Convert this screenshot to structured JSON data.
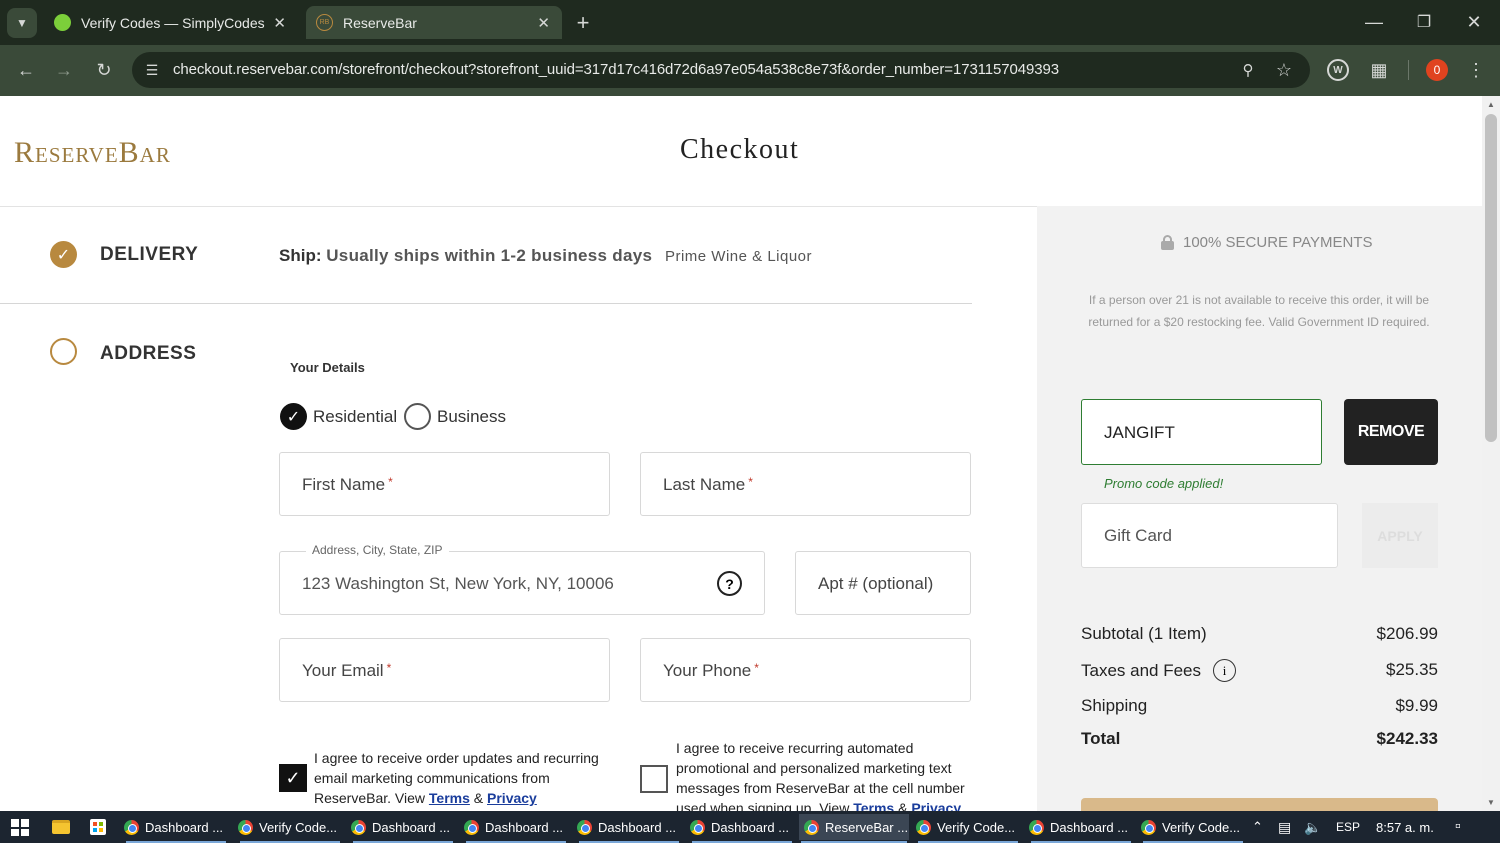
{
  "browser": {
    "tabs": [
      {
        "title": "Verify Codes — SimplyCodes",
        "close": "✕"
      },
      {
        "title": "ReserveBar",
        "favicon": "RB",
        "close": "✕"
      }
    ],
    "new_tab": "+",
    "url": "checkout.reservebar.com/storefront/checkout?storefront_uuid=317d17c416d72d6a97e054a538c8e73f&order_number=1731157049393",
    "badge_count": "0"
  },
  "header": {
    "logo": "ReserveBar",
    "title": "Checkout"
  },
  "steps": {
    "delivery": {
      "label": "DELIVERY",
      "ship_prefix": "Ship:",
      "ship_text": "Usually ships within 1-2 business days",
      "retailer": "Prime Wine & Liquor"
    },
    "address": {
      "label": "ADDRESS"
    }
  },
  "form": {
    "section_title": "Your Details",
    "residential": "Residential",
    "business": "Business",
    "first_name": "First Name",
    "last_name": "Last Name",
    "required_mark": "*",
    "address_label": "Address, City, State, ZIP",
    "address_value": "123 Washington St, New York, NY, 10006",
    "apt": "Apt # (optional)",
    "email": "Your Email",
    "phone": "Your Phone",
    "email_consent_text": "I agree to receive order updates and recurring email marketing communications from ReserveBar. View",
    "sms_consent_text": "I agree to receive recurring automated promotional and personalized marketing text messages from ReserveBar at the cell number used when signing up. View",
    "terms": "Terms",
    "amp": "&",
    "privacy": "Privacy"
  },
  "sidebar": {
    "secure": "100% SECURE PAYMENTS",
    "notice": "If a person over 21 is not available to receive this order, it will be returned for a $20 restocking fee. Valid Government ID required.",
    "promo_value": "JANGIFT",
    "remove": "REMOVE",
    "promo_applied": "Promo code applied!",
    "gift_placeholder": "Gift Card",
    "apply": "APPLY",
    "summary": {
      "subtotal_label": "Subtotal (1 Item)",
      "subtotal": "$206.99",
      "taxes_label": "Taxes and Fees",
      "taxes": "$25.35",
      "shipping_label": "Shipping",
      "shipping": "$9.99",
      "total_label": "Total",
      "total": "$242.33"
    }
  },
  "taskbar": {
    "items": [
      "Dashboard ...",
      "Verify Code...",
      "Dashboard ...",
      "Dashboard ...",
      "Dashboard ...",
      "Dashboard ...",
      "ReserveBar ...",
      "Verify Code...",
      "Dashboard ...",
      "Verify Code..."
    ],
    "lang": "ESP",
    "time": "8:57 a. m."
  },
  "colors": {
    "gold": "#b8893f",
    "promo_green": "#2e7d32",
    "dark": "#222222"
  }
}
